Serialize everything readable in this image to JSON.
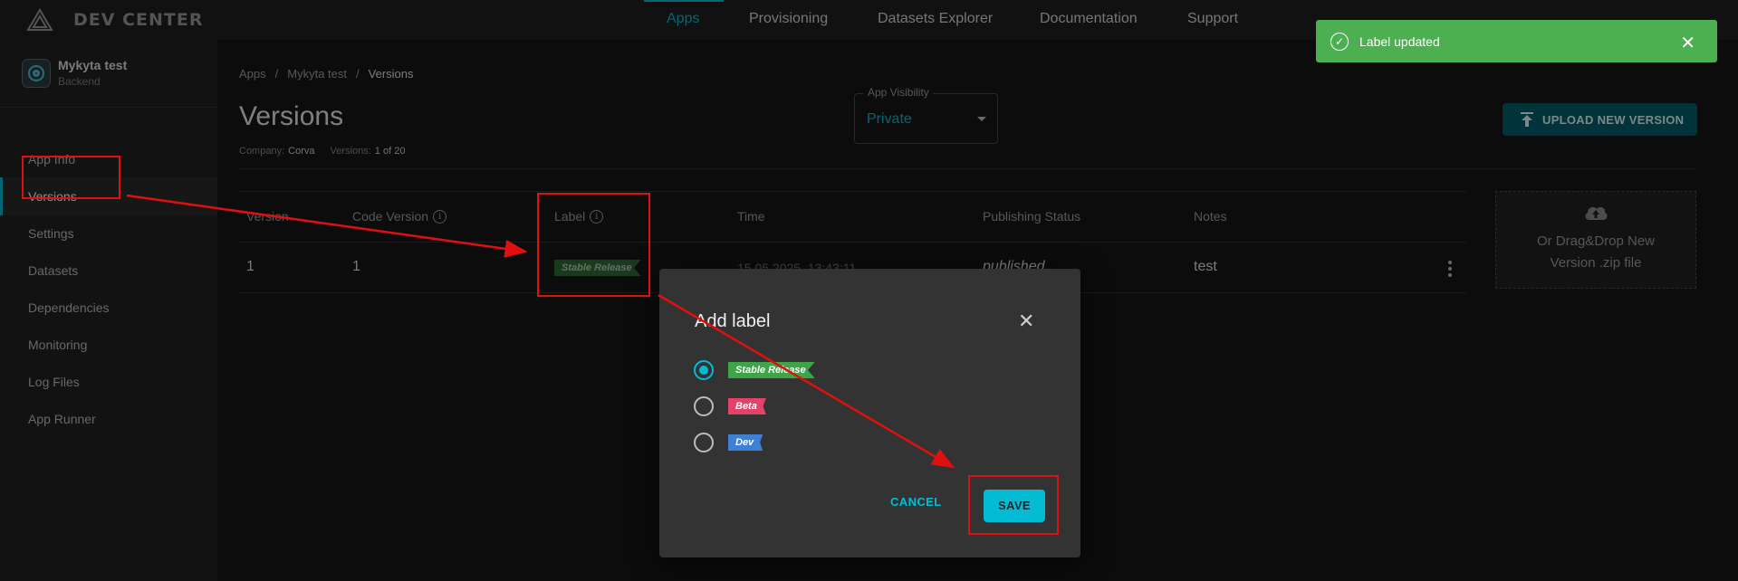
{
  "header": {
    "logo_text": "DEV CENTER",
    "nav": [
      "Apps",
      "Provisioning",
      "Datasets Explorer",
      "Documentation",
      "Support"
    ],
    "active_nav": "Apps"
  },
  "sidebar": {
    "app_name": "Mykyta test",
    "app_type": "Backend",
    "items": [
      {
        "label": "App Info"
      },
      {
        "label": "Versions",
        "active": true
      },
      {
        "label": "Settings"
      },
      {
        "label": "Datasets"
      },
      {
        "label": "Dependencies"
      },
      {
        "label": "Monitoring"
      },
      {
        "label": "Log Files"
      },
      {
        "label": "App Runner"
      }
    ]
  },
  "breadcrumb": [
    "Apps",
    "Mykyta test",
    "Versions"
  ],
  "page": {
    "title": "Versions",
    "company_label": "Company:",
    "company_value": "Corva",
    "versions_label": "Versions:",
    "versions_value": "1 of 20"
  },
  "visibility": {
    "label": "App Visibility",
    "value": "Private"
  },
  "upload_button": "UPLOAD NEW VERSION",
  "dropzone": {
    "line1": "Or Drag&Drop New",
    "line2": "Version .zip file"
  },
  "table": {
    "headers": [
      "Version",
      "Code Version",
      "Label",
      "Time",
      "Publishing Status",
      "Notes"
    ],
    "rows": [
      {
        "version": "1",
        "code_version": "1",
        "label": "Stable Release",
        "time": "15.05.2025, 13:43:11",
        "status": "published",
        "notes": "test"
      }
    ]
  },
  "toast": {
    "message": "Label updated"
  },
  "dialog": {
    "title": "Add label",
    "options": [
      {
        "label": "Stable Release",
        "color": "#3da448",
        "checked": true
      },
      {
        "label": "Beta",
        "color": "#e44369",
        "checked": false
      },
      {
        "label": "Dev",
        "color": "#3d80d6",
        "checked": false
      }
    ],
    "cancel_label": "CANCEL",
    "save_label": "SAVE"
  },
  "colors": {
    "accent": "#03bcd4",
    "toast_success": "#4caf50",
    "annotation": "#e01010"
  }
}
